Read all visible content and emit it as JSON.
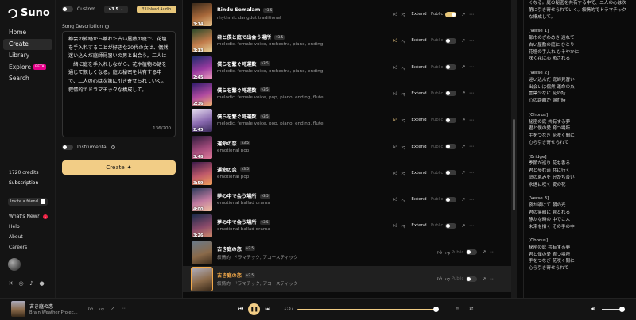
{
  "app": {
    "name": "Suno"
  },
  "sidebar": {
    "items": [
      {
        "label": "Home"
      },
      {
        "label": "Create"
      },
      {
        "label": "Library"
      },
      {
        "label": "Explore",
        "badge": "BETA"
      },
      {
        "label": "Search"
      }
    ],
    "credits": "1720 credits",
    "subscription": "Subscription",
    "invite": "Invite a friend",
    "links": [
      {
        "label": "What's New?",
        "count": "1"
      },
      {
        "label": "Help"
      },
      {
        "label": "About"
      },
      {
        "label": "Careers"
      }
    ]
  },
  "create": {
    "custom_label": "Custom",
    "custom_on": false,
    "version": "v3.5",
    "upload_label": "Upload Audio",
    "desc_label": "Song Description",
    "description": "都会の雑踏から離れた古い屋敷の庭で、花壇を手入れすることが好きな20代の女は、偶然迷い込んだ庭師見習いの男と出会う。二人は一緒に庭を手入れしながら、花や植物の話を通じて親しくなる。庭の秘密を共有する中で、二人の心は次第に引き寄せられていく。叙情的でドラマチックな構成して。",
    "char_count": "136/200",
    "instrumental_label": "Instrumental",
    "create_label": "Create"
  },
  "songs": [
    {
      "title": "Rindu Semalam",
      "version": "v3.5",
      "tags": "rhythmic dangdut traditional",
      "duration": "3:14",
      "liked": false,
      "extend": "Extend",
      "public_label": "Public",
      "public_on": true,
      "colors": [
        "#3a2a1a",
        "#a8683a",
        "#e7c38a"
      ]
    },
    {
      "title": "君と僕と庭で出会う場所",
      "version": "v3.5",
      "tags": "melodic, female voice, orchestra, piano, ending",
      "duration": "3:13",
      "liked": true,
      "extend": "Extend",
      "public_label": "Public",
      "public_on": false,
      "colors": [
        "#2b4a2a",
        "#c07a4a",
        "#e9d59a"
      ]
    },
    {
      "title": "僕らを繋ぐ時運数",
      "version": "v3.5",
      "tags": "melodic, female voice, orchestra, piano, ending",
      "duration": "2:45",
      "liked": false,
      "extend": "Extend",
      "public_label": "Public",
      "public_on": false,
      "colors": [
        "#1a2a6a",
        "#9a3aa0",
        "#f2a0c0"
      ]
    },
    {
      "title": "僕らを繋ぐ時運数",
      "version": "v3.5",
      "tags": "melodic, female voice, pop, piano, ending, flute",
      "duration": "2:36",
      "liked": false,
      "extend": "Extend",
      "public_label": "Public",
      "public_on": false,
      "colors": [
        "#2a1a6a",
        "#b04aa0",
        "#f0b070"
      ]
    },
    {
      "title": "僕らを繋ぐ時運数",
      "version": "v3.5",
      "tags": "melodic, female voice, pop, piano, ending, flute",
      "duration": "2:45",
      "liked": true,
      "extend": "Extend",
      "public_label": "Public",
      "public_on": false,
      "colors": [
        "#e8e0f0",
        "#8a6ab0",
        "#3a2a5a"
      ]
    },
    {
      "title": "運命の恋",
      "version": "v3.5",
      "tags": "emotional pop",
      "duration": "3:48",
      "liked": false,
      "extend": "Extend",
      "public_label": "Public",
      "public_on": false,
      "colors": [
        "#2a1a3a",
        "#a04a7a",
        "#e07a9a"
      ]
    },
    {
      "title": "運命の恋",
      "version": "v3.5",
      "tags": "emotional pop",
      "duration": "3:59",
      "liked": false,
      "extend": "Extend",
      "public_label": "Public",
      "public_on": false,
      "colors": [
        "#3a1a4a",
        "#c05a6a",
        "#f0a05a"
      ]
    },
    {
      "title": "夢の中で会う場所",
      "version": "v3.5",
      "tags": "emotional ballad drama",
      "duration": "4:00",
      "liked": false,
      "extend": "Extend",
      "public_label": "Public",
      "public_on": false,
      "colors": [
        "#2a3a5a",
        "#c07aa0",
        "#f0c0a0"
      ]
    },
    {
      "title": "夢の中で会う場所",
      "version": "v3.5",
      "tags": "emotional ballad drama",
      "duration": "3:26",
      "liked": false,
      "extend": "Extend",
      "public_label": "Public",
      "public_on": false,
      "colors": [
        "#1a2a4a",
        "#8a4a6a",
        "#d08a6a"
      ]
    },
    {
      "title": "古き庭の恋",
      "version": "v3.5",
      "tags": "叙情的, ドラマチック, アコースティック",
      "duration": "",
      "liked": false,
      "extend": "",
      "public_label": "Public",
      "public_on": false,
      "colors": [
        "#6a7a8a",
        "#8a6a4a",
        "#3a2a1a"
      ]
    },
    {
      "title": "古き庭の恋",
      "version": "v3.5",
      "tags": "叙情的, ドラマチック, アコースティック",
      "duration": "",
      "liked": false,
      "extend": "",
      "public_label": "Public",
      "public_on": false,
      "colors": [
        "#b0b0c0",
        "#8a6a4a",
        "#3a2a1a"
      ],
      "selected": true
    }
  ],
  "lyrics": [
    "くなる。庭の秘密を共有する中で、二人の心は次\n第に引き寄せられていく。叙情的でドラマチック\nな構成して。",
    "[Verse 1]\n都市のざわめき 遠れて\n古い屋敷の庭に ひとり\n花壇の手入れ ひそやかに\n咲く花に心 癒される",
    "[Verse 2]\n迷い込んだ 庭師見習い\n出会いは偶然 運命の糸\n言葉少なに 花の話\n心の距離が 縮む時",
    "[Chorus]\n秘密の庭 共有する夢\n君と僕の愛 育つ場所\n手をつなぎ 花咲く間に\n心ら引き寄せられて",
    "[Bridge]\n季節が巡り 花も香る\n君と歩む道 共に行く\n庭の恵みを 分かち合い\n永遠に咲く 愛の花",
    "[Verse 3]\n夜が明けて 朝の光\n君の笑顔に 見とれる\n静かな時の 中でこ人\n未来を描く その手の中",
    "[Chorus]\n秘密の庭 共有する夢\n君と僕の愛 育つ場所\n手をつなぎ 花咲く間に\n心ら引き寄せられて"
  ],
  "player": {
    "title": "古き庭の恋",
    "subtitle": "Brain Weather Projec...",
    "time": "1:37",
    "progress": 0.99,
    "volume": 0.9
  }
}
